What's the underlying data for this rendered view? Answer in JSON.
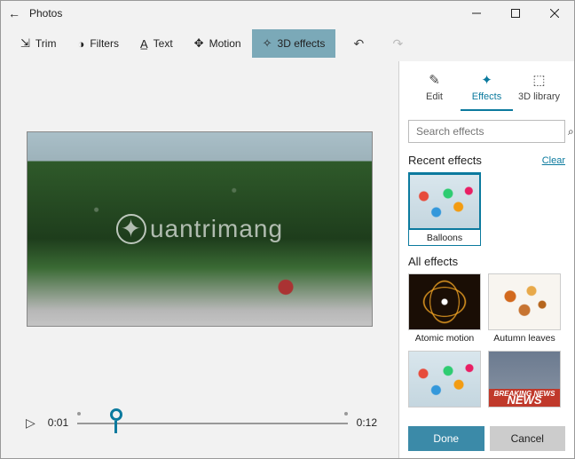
{
  "window": {
    "title": "Photos"
  },
  "toolbar": {
    "trim": "Trim",
    "filters": "Filters",
    "text": "Text",
    "motion": "Motion",
    "effects3d": "3D effects"
  },
  "timeline": {
    "current": "0:01",
    "total": "0:12"
  },
  "side": {
    "tabs": {
      "edit": "Edit",
      "effects": "Effects",
      "library": "3D library"
    },
    "search_placeholder": "Search effects",
    "recent_title": "Recent effects",
    "clear": "Clear",
    "all_title": "All effects",
    "recent": [
      {
        "name": "Balloons"
      }
    ],
    "all": [
      {
        "name": "Atomic motion"
      },
      {
        "name": "Autumn leaves"
      }
    ],
    "done": "Done",
    "cancel": "Cancel"
  },
  "watermark": "uantrimang"
}
